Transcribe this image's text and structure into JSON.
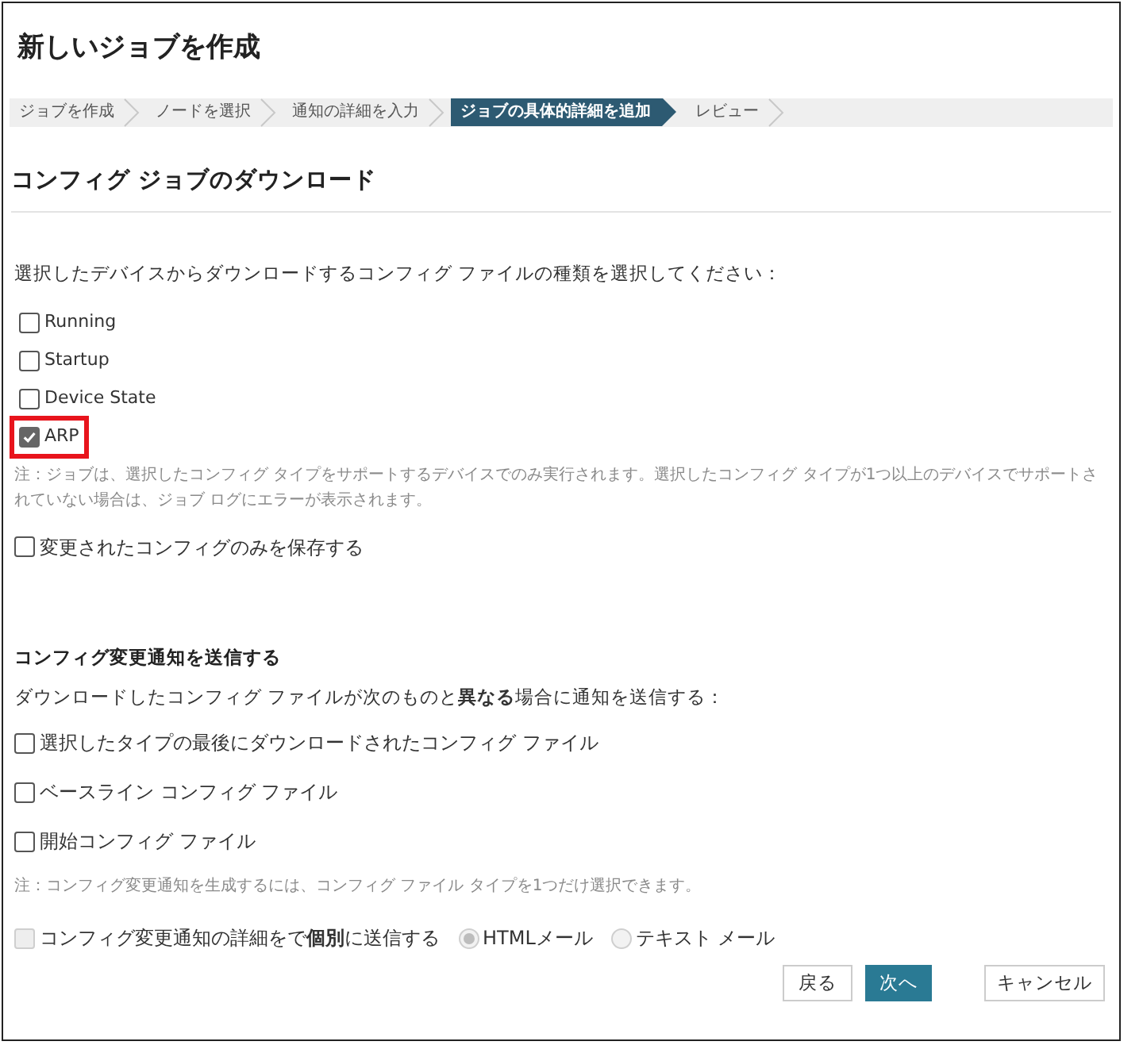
{
  "title": "新しいジョブを作成",
  "steps": [
    {
      "label": "ジョブを作成",
      "selected": false
    },
    {
      "label": "ノードを選択",
      "selected": false
    },
    {
      "label": "通知の詳細を入力",
      "selected": false
    },
    {
      "label": "ジョブの具体的詳細を追加",
      "selected": true
    },
    {
      "label": "レビュー",
      "selected": false
    }
  ],
  "section_title": "コンフィグ ジョブのダウンロード",
  "prompt": "選択したデバイスからダウンロードするコンフィグ ファイルの種類を選択してください：",
  "config_types": [
    {
      "label": "Running",
      "checked": false,
      "highlighted": false
    },
    {
      "label": "Startup",
      "checked": false,
      "highlighted": false
    },
    {
      "label": "Device State",
      "checked": false,
      "highlighted": false
    },
    {
      "label": "ARP",
      "checked": true,
      "highlighted": true
    }
  ],
  "note1": "注：ジョブは、選択したコンフィグ タイプをサポートするデバイスでのみ実行されます。選択したコンフィグ タイプが1つ以上のデバイスでサポートされていない場合は、ジョブ ログにエラーが表示されます。",
  "save_changed_only": {
    "label": "変更されたコンフィグのみを保存する",
    "checked": false
  },
  "notify_title": "コンフィグ変更通知を送信する",
  "notify_prompt": "ダウンロードしたコンフィグ ファイルが次のものと**異なる**場合に通知を送信する：",
  "notify_options": [
    {
      "label": "選択したタイプの最後にダウンロードされたコンフィグ ファイル",
      "checked": false
    },
    {
      "label": "ベースライン コンフィグ ファイル",
      "checked": false
    },
    {
      "label": "開始コンフィグ ファイル",
      "checked": false
    }
  ],
  "note2": "注：コンフィグ変更通知を生成するには、コンフィグ ファイル タイプを1つだけ選択できます。",
  "send_individually": {
    "label": "コンフィグ変更通知の詳細をで**個別**に送信する",
    "checked": false,
    "disabled": true
  },
  "mail_formats": [
    {
      "label": "HTMLメール",
      "selected": true,
      "disabled": true
    },
    {
      "label": "テキスト メール",
      "selected": false,
      "disabled": true
    }
  ],
  "buttons": [
    {
      "label": "戻る",
      "kind": "secondary"
    },
    {
      "label": "次へ",
      "kind": "primary"
    },
    {
      "label": "キャンセル",
      "kind": "cancel"
    }
  ]
}
